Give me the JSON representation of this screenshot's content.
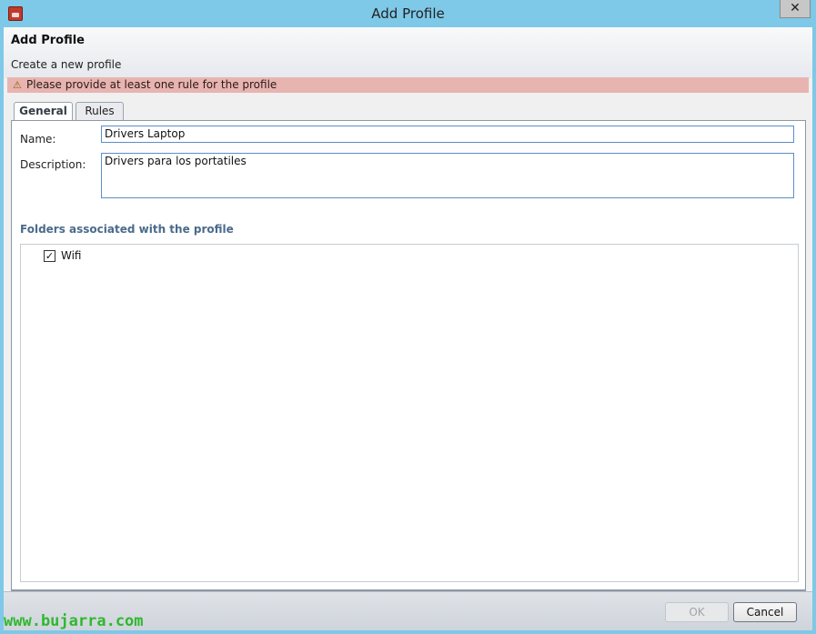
{
  "window": {
    "title": "Add Profile",
    "close_label": "✕"
  },
  "dialog": {
    "title": "Add Profile",
    "subtitle": "Create a new profile"
  },
  "warning": {
    "icon": "warning-triangle-icon",
    "text": "Please provide at least one rule for the profile"
  },
  "tabs": [
    {
      "label": "General",
      "selected": true
    },
    {
      "label": "Rules",
      "selected": false
    }
  ],
  "general": {
    "name_label": "Name:",
    "name_value": "Drivers Laptop",
    "description_label": "Description:",
    "description_value": "Drivers para los portatiles",
    "folders_heading": "Folders associated with the profile",
    "folders": [
      {
        "label": "Wifi",
        "checked": true
      }
    ]
  },
  "buttons": {
    "ok": "OK",
    "cancel": "Cancel"
  },
  "watermark": "www.bujarra.com"
}
